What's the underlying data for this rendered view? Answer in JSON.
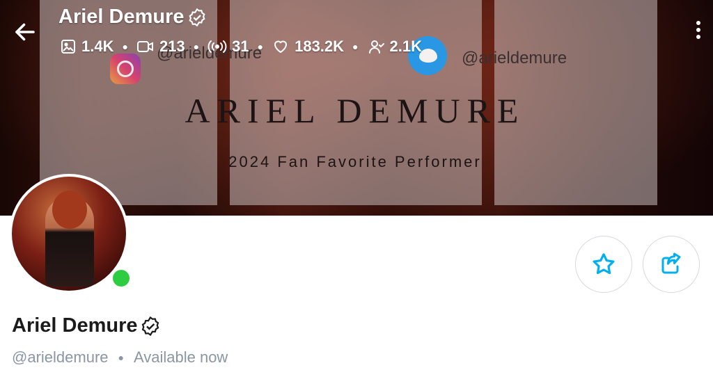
{
  "header": {
    "name": "Ariel Demure",
    "stats": {
      "photos": "1.4K",
      "videos": "213",
      "streams": "31",
      "likes": "183.2K",
      "fans": "2.1K"
    }
  },
  "banner": {
    "title": "ARIEL DEMURE",
    "subtitle": "2024 Fan Favorite Performer",
    "instagram_handle": "@arieldemure",
    "twitter_handle": "@arieldemure"
  },
  "profile": {
    "name": "Ariel Demure",
    "username": "@arieldemure",
    "status": "Available now",
    "online": true
  },
  "colors": {
    "accent": "#00aff0",
    "online": "#2ecc40",
    "muted_text": "#8a96a3"
  },
  "icons": [
    "back-arrow-icon",
    "verified-badge-icon",
    "image-icon",
    "video-icon",
    "stream-icon",
    "heart-icon",
    "fans-icon",
    "more-vertical-icon",
    "star-icon",
    "share-icon"
  ]
}
